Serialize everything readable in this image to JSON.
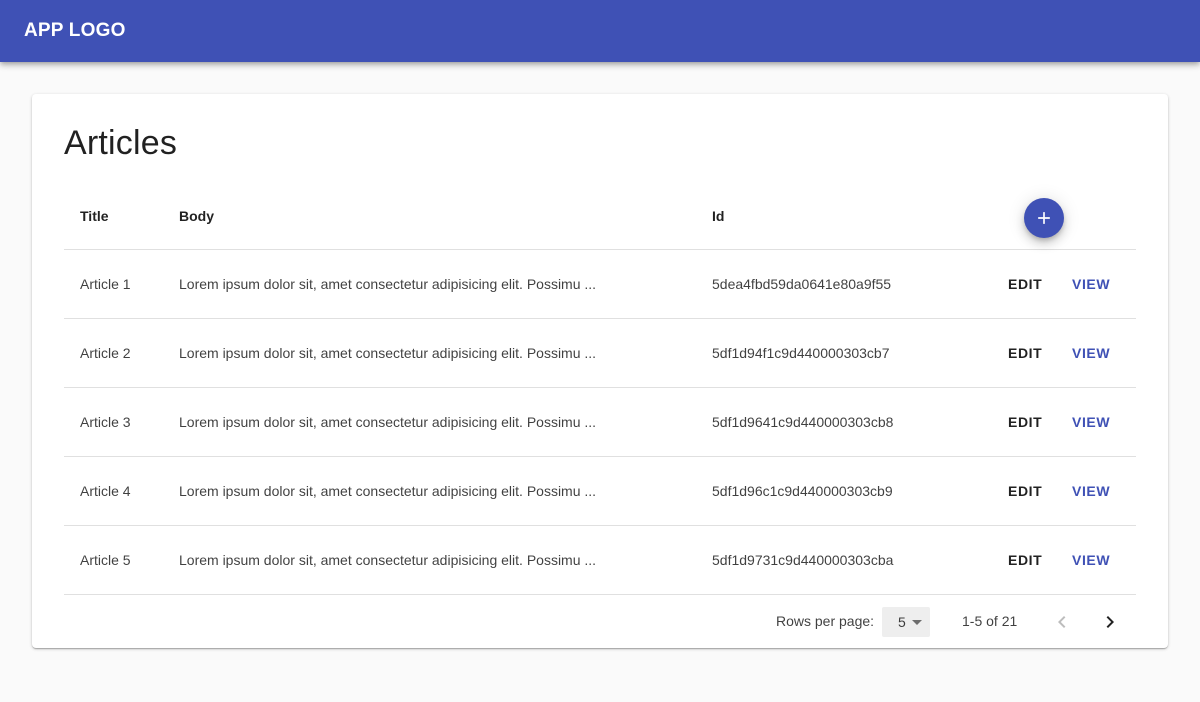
{
  "appbar": {
    "logo": "APP LOGO"
  },
  "page": {
    "title": "Articles"
  },
  "table": {
    "columns": {
      "title": "Title",
      "body": "Body",
      "id": "Id"
    },
    "rows": [
      {
        "title": "Article 1",
        "body": "Lorem ipsum dolor sit, amet consectetur adipisicing elit. Possimu ...",
        "id": "5dea4fbd59da0641e80a9f55",
        "edit": "EDIT",
        "view": "VIEW"
      },
      {
        "title": "Article 2",
        "body": "Lorem ipsum dolor sit, amet consectetur adipisicing elit. Possimu ...",
        "id": "5df1d94f1c9d440000303cb7",
        "edit": "EDIT",
        "view": "VIEW"
      },
      {
        "title": "Article 3",
        "body": "Lorem ipsum dolor sit, amet consectetur adipisicing elit. Possimu ...",
        "id": "5df1d9641c9d440000303cb8",
        "edit": "EDIT",
        "view": "VIEW"
      },
      {
        "title": "Article 4",
        "body": "Lorem ipsum dolor sit, amet consectetur adipisicing elit. Possimu ...",
        "id": "5df1d96c1c9d440000303cb9",
        "edit": "EDIT",
        "view": "VIEW"
      },
      {
        "title": "Article 5",
        "body": "Lorem ipsum dolor sit, amet consectetur adipisicing elit. Possimu ...",
        "id": "5df1d9731c9d440000303cba",
        "edit": "EDIT",
        "view": "VIEW"
      }
    ],
    "add_icon": "plus-icon"
  },
  "pagination": {
    "rows_per_page_label": "Rows per page:",
    "rows_per_page_value": "5",
    "range": "1-5 of 21",
    "prev_icon": "chevron-left-icon",
    "next_icon": "chevron-right-icon"
  },
  "colors": {
    "primary": "#3f51b5",
    "background": "#fafafa"
  }
}
